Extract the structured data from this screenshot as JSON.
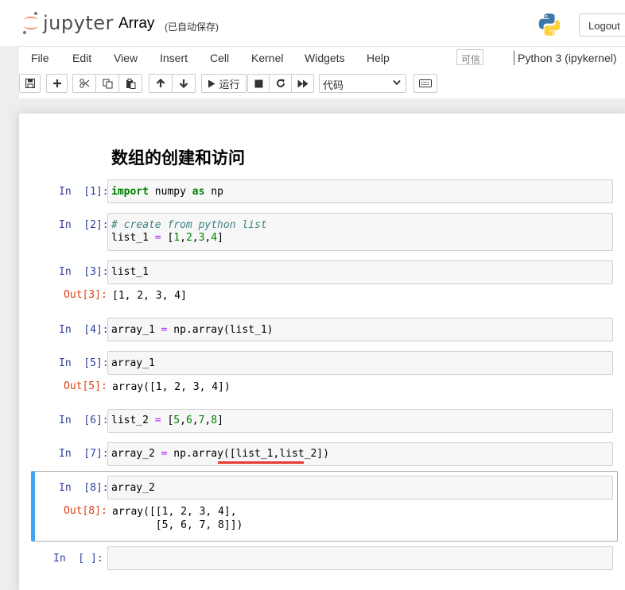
{
  "header": {
    "logo_text": "jupyter",
    "notebook_title": "Array",
    "save_status": "(已自动保存)",
    "logout_label": "Logout"
  },
  "menubar": {
    "items": [
      "File",
      "Edit",
      "View",
      "Insert",
      "Cell",
      "Kernel",
      "Widgets",
      "Help"
    ],
    "trusted_label": "可信",
    "kernel_name": "Python 3 (ipykernel)"
  },
  "toolbar": {
    "run_label": "运行",
    "cell_type": "代码"
  },
  "notebook": {
    "heading": "数组的创建和访问",
    "cells": [
      {
        "in_prompt": "In  [1]:",
        "code": "import numpy as np"
      },
      {
        "in_prompt": "In  [2]:",
        "code_line1": "# create from python list",
        "code_line2": "list_1 = [1,2,3,4]"
      },
      {
        "in_prompt": "In  [3]:",
        "code": "list_1",
        "out_prompt": "Out[3]:",
        "output": "[1, 2, 3, 4]"
      },
      {
        "in_prompt": "In  [4]:",
        "code": "array_1 = np.array(list_1)"
      },
      {
        "in_prompt": "In  [5]:",
        "code": "array_1",
        "out_prompt": "Out[5]:",
        "output": "array([1, 2, 3, 4])"
      },
      {
        "in_prompt": "In  [6]:",
        "code": "list_2 = [5,6,7,8]"
      },
      {
        "in_prompt": "In  [7]:",
        "code": "array_2 = np.array([list_1,list_2])"
      },
      {
        "in_prompt": "In  [8]:",
        "code": "array_2",
        "out_prompt": "Out[8]:",
        "output_line1": "array([[1, 2, 3, 4],",
        "output_line2": "       [5, 6, 7, 8]])"
      },
      {
        "in_prompt": "In  [ ]:",
        "code": ""
      }
    ]
  },
  "colors": {
    "keyword": "#008000",
    "operator": "#aa22ff",
    "comment": "#408080",
    "in_prompt": "#303f9f",
    "out_prompt": "#d84315",
    "selected_cell_bar": "#42a5f5",
    "annotation_underline": "#e53935"
  }
}
